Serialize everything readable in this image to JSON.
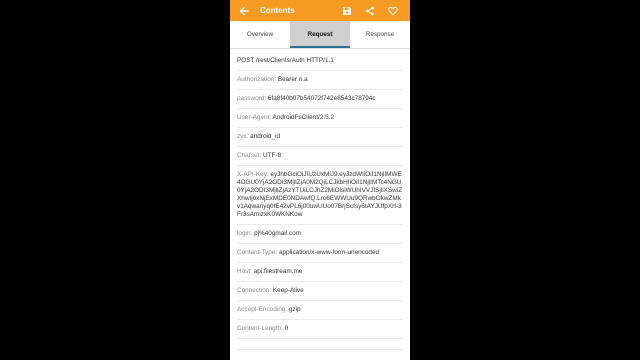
{
  "appbar": {
    "title": "Contents",
    "icons": [
      "back-arrow-icon",
      "save-icon",
      "share-icon",
      "heart-icon"
    ]
  },
  "tabs": [
    {
      "label": "Overview",
      "active": false
    },
    {
      "label": "Request",
      "active": true
    },
    {
      "label": "Response",
      "active": false
    }
  ],
  "request": {
    "request_line": "POST /rest/Clients/Auth HTTP/1.1",
    "headers": [
      {
        "key": "Authorization:",
        "value": "Bearer n.a"
      },
      {
        "key": "password:",
        "value": "6fa8f40b07b54072f742e8543c78794c"
      },
      {
        "key": "User-Agent:",
        "value": "AndroidFsClient/2.5.2"
      },
      {
        "key": "zyx:",
        "value": "android_id"
      },
      {
        "key": "Charset:",
        "value": "UTF-8"
      },
      {
        "key": "X-API-Key:",
        "value": "eyJhbGciOiJIUzUxMiJ9.eyJzdWIiOiI1NjlIMWE4OGU0YjA2ODI3MjllZjA0M2QiLCJkbHIiOiI1NjlIMTc4NGU0YjA2ODI3MjllZjAzYTUiLCJhZ2MiOlsiWUhIVVJISjliXSwiZXhwIjoxNjExMDE0NDAwfQ.Lro6EWWUu9QRwbOkwZMkv1Aqwanyq0fE42vPL6j00uwUUo07BrjScfsy6tAYJUfpXrf-3Fr3sAmizxK0WKNKow"
      },
      {
        "key": "login:",
        "value": "pj%40gmail.com"
      },
      {
        "key": "Content-Type:",
        "value": "application/x-www-form-urlencoded"
      },
      {
        "key": "Host:",
        "value": "api.filestream.me"
      },
      {
        "key": "Connection:",
        "value": "Keep-Alive"
      },
      {
        "key": "Accept-Encoding:",
        "value": "gzip"
      },
      {
        "key": "Content-Length:",
        "value": "0"
      }
    ]
  },
  "colors": {
    "appbar": "#f59a23",
    "active_tab_bg": "#cfcfcf",
    "active_tab_indicator": "#2f6f94"
  }
}
